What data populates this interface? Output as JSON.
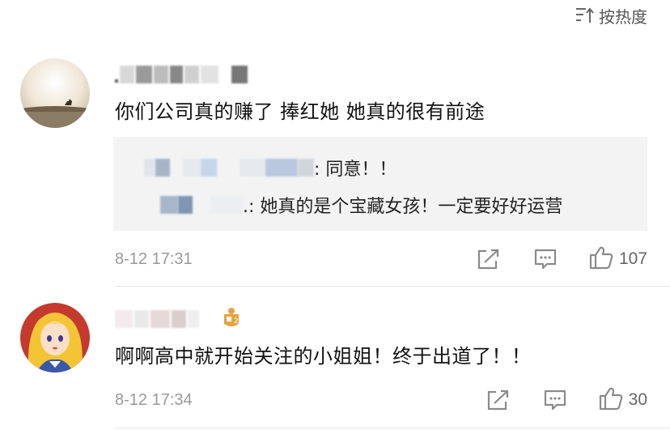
{
  "header": {
    "sort_label": "按热度",
    "sort_icon": "sort-icon"
  },
  "comments": [
    {
      "content": "你们公司真的赚了 捧红她 她真的很有前途",
      "replies": [
        {
          "text": ": 同意！！"
        },
        {
          "text": ".: 她真的是个宝藏女孩！一定要好好运营"
        }
      ],
      "timestamp": "8-12 17:31",
      "likes": "107"
    },
    {
      "content": "啊啊高中就开始关注的小姐姐！终于出道了！！",
      "timestamp": "8-12 17:34",
      "likes": "30"
    }
  ],
  "colors": {
    "background": "#ffffff",
    "reply_bg": "#f3f3f3",
    "meta_text": "#999999",
    "icon_gray": "#8a8a8a",
    "badge_gold": "#e8a33c"
  }
}
